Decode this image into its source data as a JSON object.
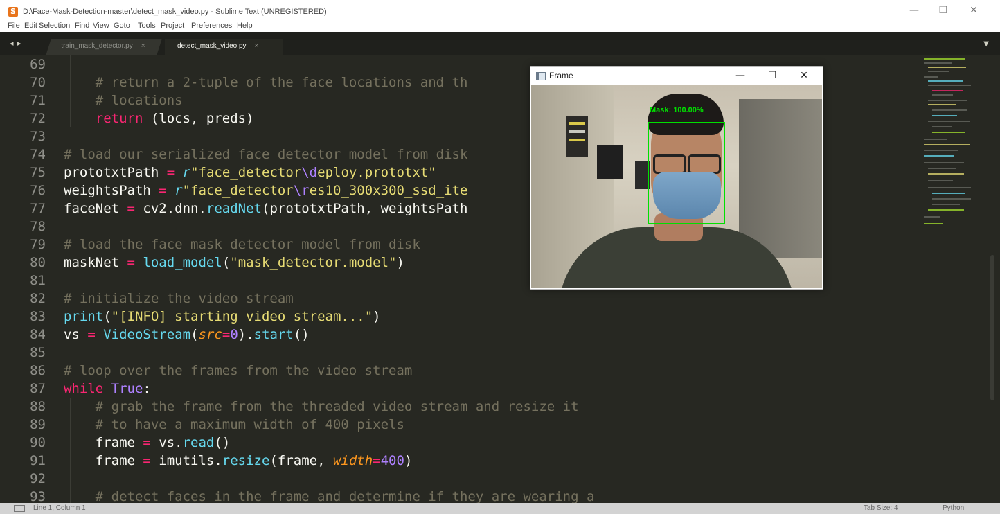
{
  "window": {
    "title": "D:\\Face-Mask-Detection-master\\detect_mask_video.py - Sublime Text (UNREGISTERED)",
    "app_icon_letter": "S",
    "controls": {
      "minimize": "—",
      "maximize": "❐",
      "close": "✕"
    }
  },
  "menu": [
    "File",
    "Edit",
    "Selection",
    "Find",
    "View",
    "Goto",
    "Tools",
    "Project",
    "Preferences",
    "Help"
  ],
  "tabs": {
    "nav_arrows": "◂ ▸",
    "items": [
      {
        "label": "train_mask_detector.py",
        "close": "×",
        "active": false
      },
      {
        "label": "detect_mask_video.py",
        "close": "×",
        "active": true
      }
    ],
    "dropdown": "▼"
  },
  "editor": {
    "line_numbers": [
      "69",
      "70",
      "71",
      "72",
      "73",
      "74",
      "75",
      "76",
      "77",
      "78",
      "79",
      "80",
      "81",
      "82",
      "83",
      "84",
      "85",
      "86",
      "87",
      "88",
      "89",
      "90",
      "91",
      "92",
      "93"
    ]
  },
  "frame_window": {
    "title": "Frame",
    "controls": {
      "minimize": "—",
      "maximize": "☐",
      "close": "✕"
    },
    "detection_label": "Mask: 100.00%"
  },
  "statusbar": {
    "position": "Line 1, Column 1",
    "tab_size": "Tab Size: 4",
    "syntax": "Python"
  },
  "colors": {
    "editor_bg": "#272822",
    "keyword": "#f92672",
    "string": "#e6db74",
    "function": "#66d9ef",
    "comment": "#75715e",
    "constant": "#ae81ff",
    "parameter": "#fd971f",
    "detection_box": "#00e000"
  }
}
